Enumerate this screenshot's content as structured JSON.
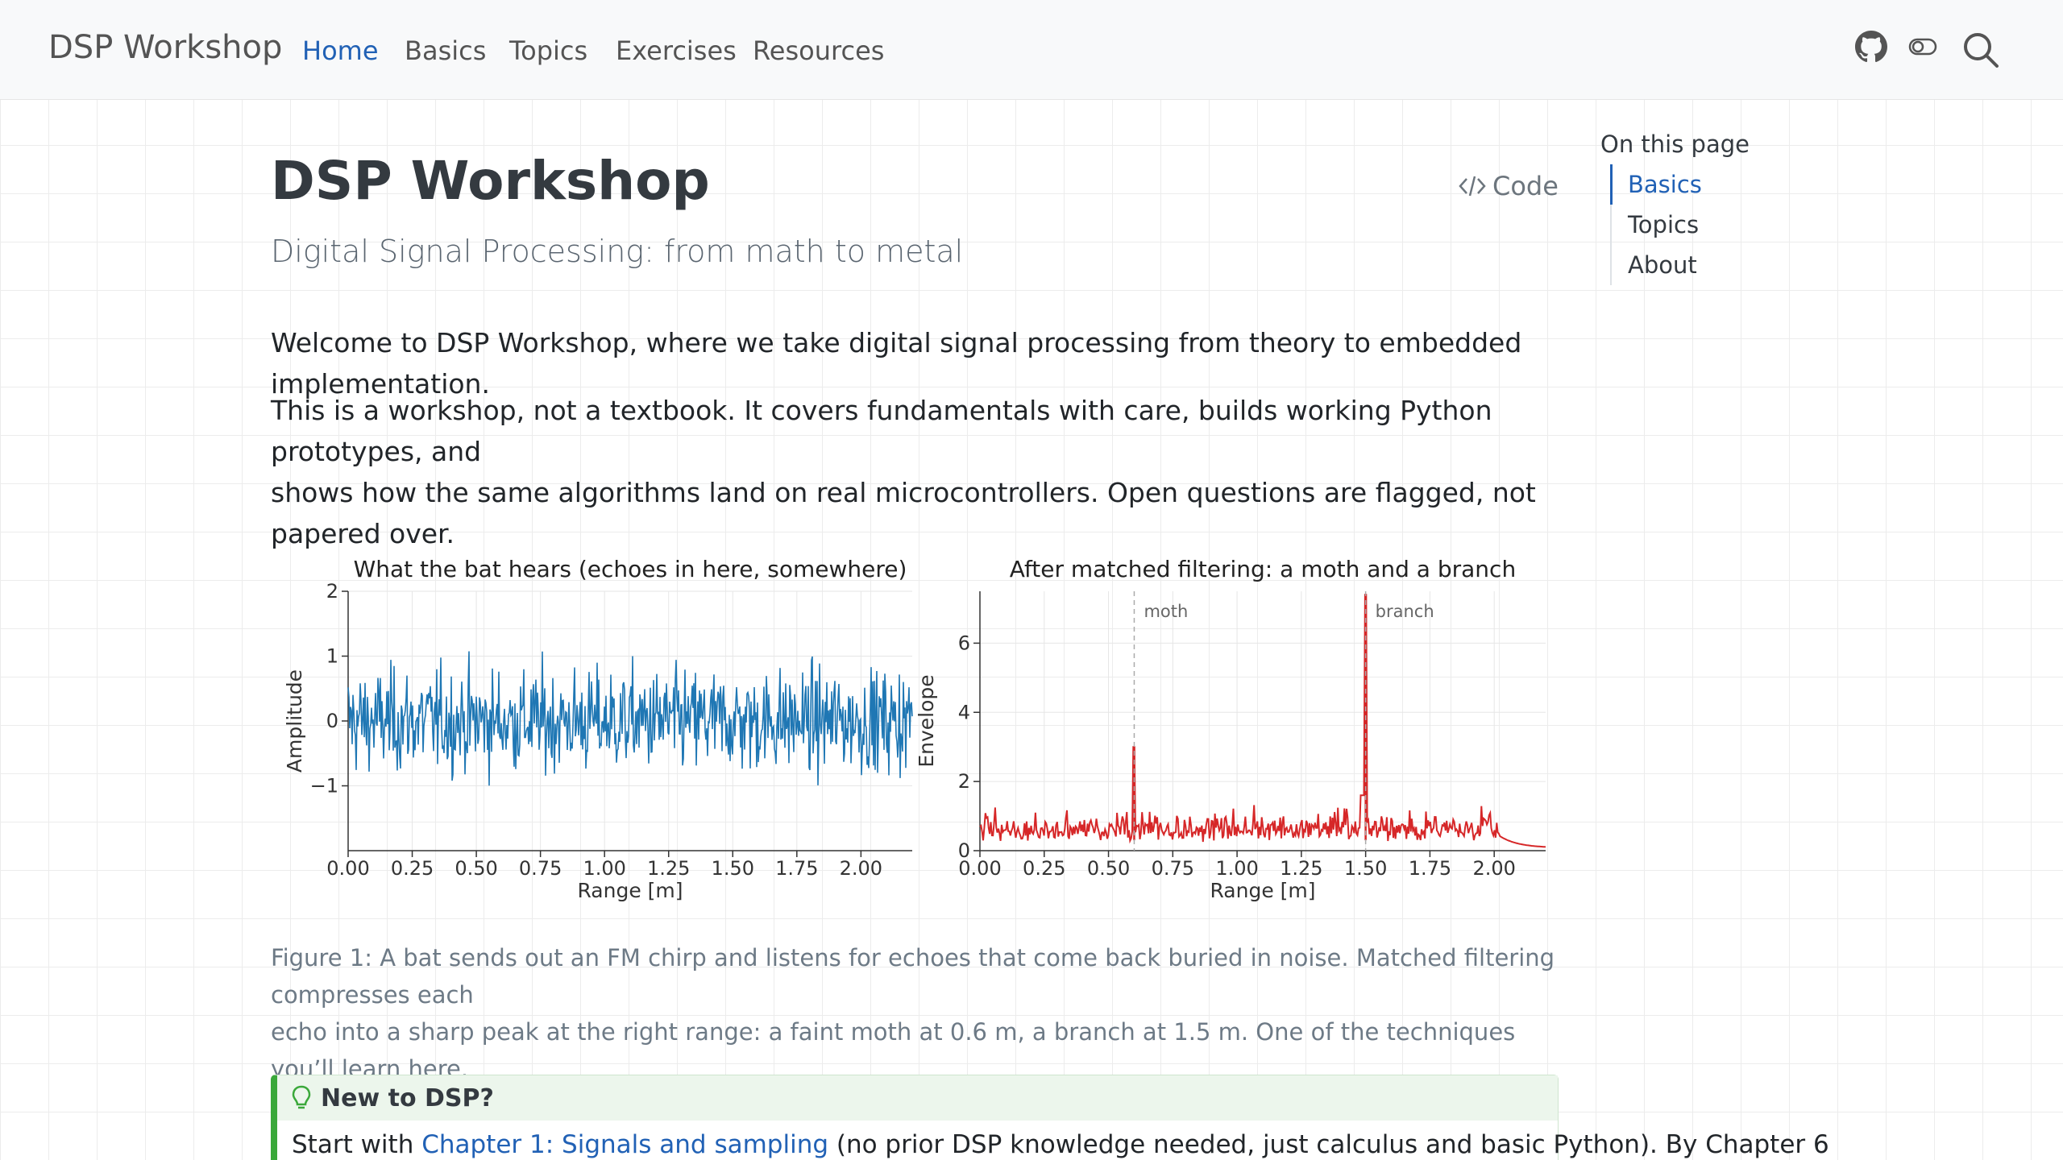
{
  "navbar": {
    "brand": "DSP Workshop",
    "links": [
      "Home",
      "Basics",
      "Topics",
      "Exercises",
      "Resources"
    ],
    "active": "Home",
    "icons": [
      "github-icon",
      "toggle-icon",
      "search-icon"
    ]
  },
  "page": {
    "title": "DSP Workshop",
    "subtitle": "Digital Signal Processing: from math to metal",
    "code_label": "Code",
    "para1": "Welcome to DSP Workshop, where we take digital signal processing from theory to embedded implementation.",
    "para2_line1": "This is a workshop, not a textbook. It covers fundamentals with care, builds working Python prototypes, and",
    "para2_line2": "shows how the same algorithms land on real microcontrollers. Open questions are flagged, not papered over.",
    "caption_line1": "Figure 1: A bat sends out an FM chirp and listens for echoes that come back buried in noise. Matched filtering compresses each",
    "caption_line2": "echo into a sharp peak at the right range: a faint moth at 0.6 m, a branch at 1.5 m. One of the techniques you’ll learn here."
  },
  "toc": {
    "title": "On this page",
    "items": [
      "Basics",
      "Topics",
      "About"
    ],
    "active": "Basics"
  },
  "callout": {
    "title": "New to DSP?",
    "body_pre": "Start with ",
    "body_link": "Chapter 1: Signals and sampling",
    "body_post": " (no prior DSP knowledge needed, just calculus and basic Python). By Chapter 6"
  },
  "chart_data": [
    {
      "type": "line",
      "title": "What the bat hears (echoes in here, somewhere)",
      "xlabel": "Range [m]",
      "ylabel": "Amplitude",
      "xlim": [
        0,
        2.2
      ],
      "ylim": [
        -2,
        2
      ],
      "xticks": [
        "0.00",
        "0.25",
        "0.50",
        "0.75",
        "1.00",
        "1.25",
        "1.50",
        "1.75",
        "2.00"
      ],
      "yticks": [
        "2",
        "1",
        "0",
        "−1"
      ],
      "series": [
        {
          "values_description": "noise-like signal, amplitude roughly within -1.9 to 1.9 across range 0 to 2.2 m",
          "color": "#1f77b4"
        }
      ],
      "grid": true
    },
    {
      "type": "line",
      "title": "After matched filtering: a moth and a branch",
      "xlabel": "Range [m]",
      "ylabel": "Envelope",
      "xlim": [
        0,
        2.2
      ],
      "ylim": [
        0,
        7.5
      ],
      "xticks": [
        "0.00",
        "0.25",
        "0.50",
        "0.75",
        "1.00",
        "1.25",
        "1.50",
        "1.75",
        "2.00"
      ],
      "yticks": [
        "0",
        "2",
        "4",
        "6"
      ],
      "annotations": [
        {
          "label": "moth",
          "x": 0.6
        },
        {
          "label": "branch",
          "x": 1.5
        }
      ],
      "peaks": [
        {
          "x": 0.6,
          "y": 3.0
        },
        {
          "x": 1.5,
          "y": 7.4
        }
      ],
      "noise_floor": 1.0,
      "series": [
        {
          "color": "#d62728"
        }
      ],
      "grid": true
    }
  ]
}
